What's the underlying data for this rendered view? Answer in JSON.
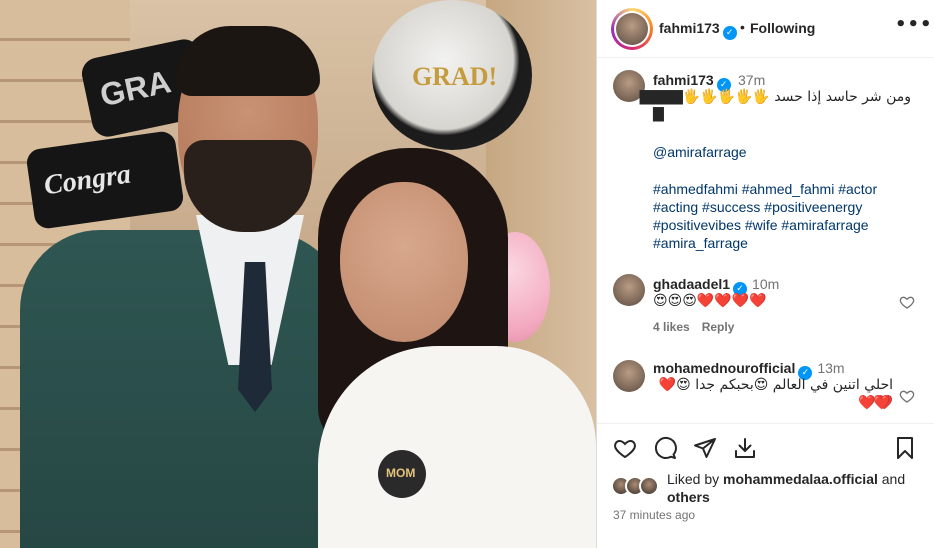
{
  "header": {
    "username": "fahmi173",
    "separator": "•",
    "follow_status": "Following",
    "more_label": "•••"
  },
  "caption": {
    "username": "fahmi173",
    "time": "37m",
    "text_line1": "ومن شر حاسد إذا حسد 🖐🖐🖐🖐🖐▇▇▇▇",
    "text_line2": "▇",
    "mention": "@amirafarrage",
    "hashtags": "#ahmedfahmi #ahmed_fahmi #actor #acting #success #positiveenergy #positivevibes #wife #amirafarrage #amira_farrage"
  },
  "comments": [
    {
      "username": "ghadaadel1",
      "time": "10m",
      "text": "😍😍😍❤️❤️❤️❤️",
      "likes": "4 likes",
      "reply": "Reply"
    },
    {
      "username": "mohamednourofficial",
      "time": "13m",
      "text_line1": "احلي اتنين في العالم 😍بحبكم جدا 😍❤️❤️❤️",
      "text_line2": "❤️"
    }
  ],
  "likes": {
    "prefix": "Liked by ",
    "user": "mohammedalaa.official",
    "suffix": " and",
    "others": "others"
  },
  "time_ago": "37 minutes ago",
  "photo": {
    "balloon_grad_text": "GRAD!",
    "balloon_congrats_text": "GRA",
    "balloon_congrats2_text": "Congra",
    "badge_text": "MOM"
  },
  "icons": {
    "verified": "✓"
  },
  "colors": {
    "verified": "#0095f6",
    "link": "#00376b",
    "secondary_text": "#737373"
  }
}
